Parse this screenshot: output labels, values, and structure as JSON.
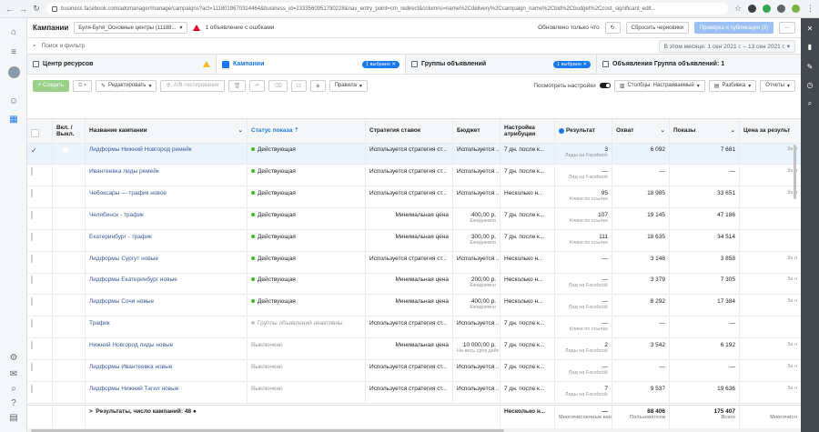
{
  "browser": {
    "url": "business.facebook.com/adsmanager/manage/campaigns?act=1118019670314464&business_id=2333560951790228&nav_entry_point=cm_redirect&columns=name%2Cdelivery%2Ccampaign_name%2Cbid%2Cbudget%2Ccost_significant_edit..."
  },
  "topbar": {
    "title": "Кампании",
    "account": "Буля-Буля_Основные центры (11188...",
    "error_text": "1 объявление с ошбками",
    "updated": "Обновлено только что",
    "discard": "Сбросить черновики",
    "publish": "Проверка и публикация (3)"
  },
  "search": {
    "placeholder": "Поиск и фильтр",
    "date_range": "В этом месяце: 1 сен 2021 г. – 13 сен 2021 г."
  },
  "tabs": [
    {
      "label": "Центр ресурсов"
    },
    {
      "label": "Кампании",
      "badge": "1 выбрано"
    },
    {
      "label": "Группы объявлений",
      "badge": "1 выбрано"
    },
    {
      "label": "Объявления Группа объявлений: 1"
    }
  ],
  "toolbar": {
    "create": "+ Создать",
    "edit": "Редактировать",
    "ab_test": "A/B-тестирование",
    "rules": "Правила",
    "view_settings": "Посмотреть настройки",
    "columns": "Столбцы: Настраиваемый",
    "breakdown": "Разбивка",
    "reports": "Отчеты"
  },
  "table": {
    "headers": {
      "toggle": "Вкл. / Выкл.",
      "name": "Название кампании",
      "status": "Статус показа",
      "strategy": "Стратегия ставок",
      "budget": "Бюджет",
      "attribution": "Настройка атрибуции",
      "result": "Результат",
      "reach": "Охват",
      "impressions": "Показы",
      "cost": "Цена за результ"
    },
    "rows": [
      {
        "name": "Лидформы Нижний Новгород ремейк",
        "status": "Действующая",
        "active": true,
        "strategy": "Используется стратегия ст...",
        "budget": "Используется ...",
        "budget_sub": "",
        "attr": "7 дн. после к...",
        "result": "3",
        "result_sub": "Лиды на Facebook",
        "reach": "6 092",
        "imp": "7 681",
        "cost": "",
        "cost_sub": "За л",
        "selected": true
      },
      {
        "name": "Ивантеевка лиды ремейк",
        "status": "Действующая",
        "active": true,
        "strategy": "Используется стратегия ст...",
        "budget": "Используется ...",
        "budget_sub": "",
        "attr": "7 дн. после к...",
        "result": "—",
        "result_sub": "Лид на Facebook",
        "reach": "—",
        "imp": "—",
        "cost": "",
        "cost_sub": "За л",
        "selected": false
      },
      {
        "name": "Чебоксары — трафик новое",
        "status": "Действующая",
        "active": true,
        "strategy": "Используется стратегия ст...",
        "budget": "Используется ...",
        "budget_sub": "",
        "attr": "Несколько н...",
        "result": "95",
        "result_sub": "Клики по ссылке",
        "reach": "18 985",
        "imp": "33 651",
        "cost": "",
        "cost_sub": "За л",
        "selected": false
      },
      {
        "name": "Челябинск - трафик",
        "status": "Действующая",
        "active": true,
        "strategy": "Минимальная цена",
        "budget": "400,00 р.",
        "budget_sub": "Ежедневно",
        "attr": "7 дн. после к...",
        "result": "107",
        "result_sub": "Клики по ссылке",
        "reach": "19 145",
        "imp": "47 186",
        "cost": "",
        "cost_sub": "",
        "selected": false
      },
      {
        "name": "Екатеринбург - трафик",
        "status": "Действующая",
        "active": true,
        "strategy": "Минимальная цена",
        "budget": "300,00 р.",
        "budget_sub": "Ежедневно",
        "attr": "7 дн. после к...",
        "result": "111",
        "result_sub": "Клики по ссылке",
        "reach": "18 635",
        "imp": "34 514",
        "cost": "",
        "cost_sub": "",
        "selected": false
      },
      {
        "name": "Лидформы Сургут новые",
        "status": "Действующая",
        "active": true,
        "strategy": "Используется стратегия ст...",
        "budget": "Используется ...",
        "budget_sub": "",
        "attr": "Несколько н...",
        "result": "—",
        "result_sub": "",
        "reach": "3 148",
        "imp": "3 858",
        "cost": "",
        "cost_sub": "За л",
        "selected": false
      },
      {
        "name": "Лидформы Екатеринбург новые",
        "status": "Действующая",
        "active": true,
        "strategy": "Минимальная цена",
        "budget": "200,00 р.",
        "budget_sub": "Ежедневно",
        "attr": "Несколько н...",
        "result": "—",
        "result_sub": "Лид на Facebook",
        "reach": "3 379",
        "imp": "7 305",
        "cost": "",
        "cost_sub": "За л",
        "selected": false
      },
      {
        "name": "Лидформы Сочи новые",
        "status": "Действующая",
        "active": true,
        "strategy": "Минимальная цена",
        "budget": "400,00 р.",
        "budget_sub": "Ежедневно",
        "attr": "Несколько н...",
        "result": "—",
        "result_sub": "Лид на Facebook",
        "reach": "8 292",
        "imp": "17 384",
        "cost": "",
        "cost_sub": "За л",
        "selected": false
      },
      {
        "name": "Трафик",
        "status": "Группы объявлений неактивны",
        "active": false,
        "strategy": "Используется стратегия ст...",
        "budget": "Используется ...",
        "budget_sub": "",
        "attr": "7 дн. после к...",
        "result": "—",
        "result_sub": "Клики по ссылке",
        "reach": "—",
        "imp": "—",
        "cost": "",
        "cost_sub": "",
        "selected": false
      },
      {
        "name": "Нижний Новгород лиды новые",
        "status": "Выключено",
        "active": false,
        "strategy": "Минимальная цена",
        "budget": "10 000,00 р.",
        "budget_sub": "На весь срок дейс...",
        "attr": "7 дн. после к...",
        "result": "2",
        "result_sub": "Лиды на Facebook",
        "reach": "3 542",
        "imp": "6 192",
        "cost": "",
        "cost_sub": "За л",
        "selected": false
      },
      {
        "name": "Лидформы Ивантеевка новые",
        "status": "Выключено",
        "active": false,
        "strategy": "Используется стратегия ст...",
        "budget": "Используется ...",
        "budget_sub": "",
        "attr": "7 дн. после к...",
        "result": "—",
        "result_sub": "Лид на Facebook",
        "reach": "—",
        "imp": "—",
        "cost": "",
        "cost_sub": "За л",
        "selected": false
      },
      {
        "name": "Лидформы Нижний Тагил новые",
        "status": "Выключено",
        "active": false,
        "strategy": "Используется стратегия ст...",
        "budget": "Используется ...",
        "budget_sub": "",
        "attr": "7 дн. после к...",
        "result": "7",
        "result_sub": "Лиды на Facebook",
        "reach": "9 537",
        "imp": "19 636",
        "cost": "",
        "cost_sub": "За л",
        "selected": false
      }
    ],
    "total": {
      "label": "Результаты, число кампаний: 48",
      "attr": "Несколько н...",
      "result_sub": "Многочисленные конве",
      "reach": "88 406",
      "reach_sub": "Пользователи",
      "imp": "175 407",
      "imp_sub": "Всего",
      "cost_sub": "Многочисл"
    }
  }
}
